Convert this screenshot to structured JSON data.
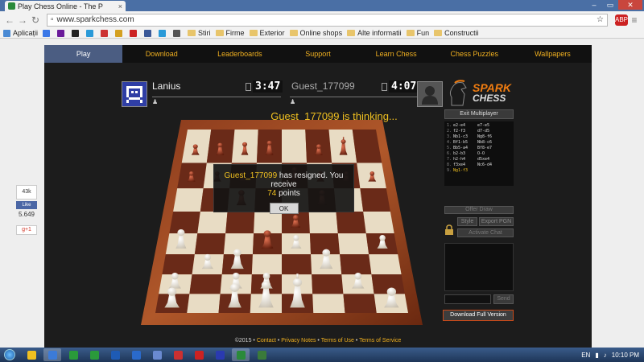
{
  "browser": {
    "tab_title": "Play Chess Online - The P",
    "tab_close": "×",
    "url": "www.sparkchess.com",
    "window_controls": [
      "–",
      "▭",
      "✕"
    ],
    "ext_abp": "ABP"
  },
  "bookmarks": [
    {
      "label": "Aplicații",
      "color": "#4a8ad4"
    },
    {
      "label": "",
      "color": "#3b78e7"
    },
    {
      "label": "",
      "color": "#6a1b9a"
    },
    {
      "label": "",
      "color": "#222222"
    },
    {
      "label": "",
      "color": "#2a9ad8"
    },
    {
      "label": "",
      "color": "#cc3333"
    },
    {
      "label": "",
      "color": "#d4a020"
    },
    {
      "label": "",
      "color": "#cc2222"
    },
    {
      "label": "",
      "color": "#3b5998"
    },
    {
      "label": "",
      "color": "#2a9ad8"
    },
    {
      "label": "",
      "color": "#555555"
    }
  ],
  "bookmark_folders": [
    "Stiri",
    "Firme",
    "Exterior",
    "Online shops",
    "Alte informatii",
    "Fun",
    "Constructii"
  ],
  "nav": {
    "items": [
      "Play",
      "Download",
      "Leaderboards",
      "Support",
      "Learn Chess",
      "Chess Puzzles",
      "Wallpapers"
    ]
  },
  "players": {
    "left": {
      "name": "Lanius",
      "clock": "3:47"
    },
    "right": {
      "name": "Guest_177099",
      "clock": "4:07"
    }
  },
  "status": "Guest_177099 is thinking...",
  "dialog": {
    "line1_name": "Guest_177099",
    "line1_rest": " has resigned. You receive",
    "points": "74",
    "points_unit": " points",
    "ok": "OK"
  },
  "logo": {
    "spark": "SPARK",
    "chess": "CHESS"
  },
  "panel": {
    "exit_multiplayer": "Exit Multiplayer",
    "offer_draw": "Offer Draw",
    "style": "Style",
    "export_pgn": "Export PGN",
    "activate_chat": "Activate Chat",
    "send": "Send",
    "download": "Download Full Version"
  },
  "moves": [
    {
      "n": "1.",
      "w": "e2-e4",
      "b": "e7-e5"
    },
    {
      "n": "2.",
      "w": "f2-f3",
      "b": "d7-d5"
    },
    {
      "n": "3.",
      "w": "Nb1-c3",
      "b": "Ng8-f6"
    },
    {
      "n": "4.",
      "w": "Bf1-b5",
      "b": "Nb8-c6"
    },
    {
      "n": "5.",
      "w": "Bb5-a4",
      "b": "Bf8-e7"
    },
    {
      "n": "6.",
      "w": "b2-b3",
      "b": "O-O"
    },
    {
      "n": "7.",
      "w": "h2-h4",
      "b": "d5xe4"
    },
    {
      "n": "8.",
      "w": "f3xe4",
      "b": "Nc6-d4"
    },
    {
      "n": "9.",
      "w": "Ng1-f3",
      "b": ""
    }
  ],
  "footer": {
    "copyright": "©2015 • ",
    "contact": "Contact",
    "privacy": "Privacy Notes",
    "terms_use": "Terms of Use",
    "terms_service": "Terms of Service",
    "sep": " • "
  },
  "social": {
    "likes": "43k",
    "like_label": "Like",
    "fb_count": "5.649",
    "gplus": "g+1"
  },
  "taskbar": {
    "apps": [
      "#f0c020",
      "#3c7bd8",
      "#2a9a3a",
      "#2a9a3a",
      "#1e5bb5",
      "#2a6acb",
      "#6a8ad0",
      "#cc3030",
      "#cc2222",
      "#2a3ab0",
      "#2a8a3a",
      "#3a7a3a"
    ],
    "lang": "EN",
    "time": "10:10 PM"
  },
  "colors": {
    "accent": "#f0b020",
    "nav_active": "#4b5d82",
    "light_square": "#e8dcc4",
    "dark_square": "#6a2a18"
  }
}
